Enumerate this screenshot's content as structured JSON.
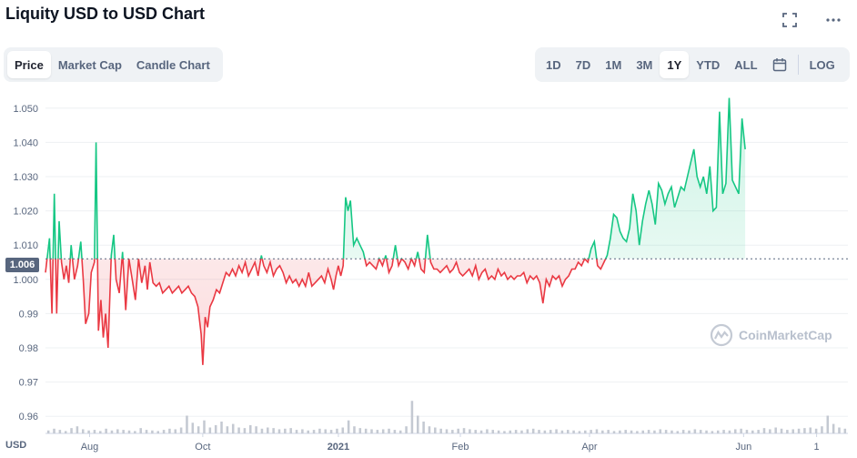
{
  "header": {
    "title": "Liquity USD to USD Chart"
  },
  "icons": {
    "fullscreen": "fullscreen-icon",
    "more": "more-icon",
    "calendar": "calendar-icon",
    "watermark": "coinmarketcap-logo-icon"
  },
  "tabs_left": [
    {
      "label": "Price",
      "active": true
    },
    {
      "label": "Market Cap",
      "active": false
    },
    {
      "label": "Candle Chart",
      "active": false
    }
  ],
  "tabs_right": [
    {
      "label": "1D",
      "active": false
    },
    {
      "label": "7D",
      "active": false
    },
    {
      "label": "1M",
      "active": false
    },
    {
      "label": "3M",
      "active": false
    },
    {
      "label": "1Y",
      "active": true
    },
    {
      "label": "YTD",
      "active": false
    },
    {
      "label": "ALL",
      "active": false
    }
  ],
  "log_label": "LOG",
  "watermark_text": "CoinMarketCap",
  "colors": {
    "up": "#16c784",
    "down": "#ea3943",
    "grid": "#eef0f3",
    "volume": "#c4c9d2"
  },
  "chart_data": {
    "type": "line",
    "reference_value": 1.006,
    "reference_label": "1.006",
    "y_unit_label": "USD",
    "ylim": [
      0.955,
      1.055
    ],
    "y_ticks": [
      0.96,
      0.97,
      0.98,
      0.99,
      1.0,
      1.01,
      1.02,
      1.03,
      1.04,
      1.05
    ],
    "y_tick_labels": [
      "0.96",
      "0.97",
      "0.98",
      "0.99",
      "1.000",
      "1.010",
      "1.020",
      "1.030",
      "1.040",
      "1.050"
    ],
    "x_ticks": [
      {
        "label": "Aug",
        "pos": 0.055
      },
      {
        "label": "Oct",
        "pos": 0.196
      },
      {
        "label": "2021",
        "pos": 0.365
      },
      {
        "label": "Feb",
        "pos": 0.517
      },
      {
        "label": "Apr",
        "pos": 0.678
      },
      {
        "label": "Jun",
        "pos": 0.87
      },
      {
        "label": "1",
        "pos": 0.961
      }
    ],
    "points": [
      [
        0.0,
        1.002
      ],
      [
        0.005,
        1.012
      ],
      [
        0.008,
        0.99
      ],
      [
        0.011,
        1.025
      ],
      [
        0.014,
        0.99
      ],
      [
        0.017,
        1.017
      ],
      [
        0.02,
        1.005
      ],
      [
        0.023,
        1.0
      ],
      [
        0.026,
        1.004
      ],
      [
        0.029,
        0.999
      ],
      [
        0.032,
        1.01
      ],
      [
        0.036,
        1.0
      ],
      [
        0.04,
        1.004
      ],
      [
        0.044,
        1.011
      ],
      [
        0.047,
        1.0
      ],
      [
        0.05,
        0.987
      ],
      [
        0.054,
        0.99
      ],
      [
        0.057,
        1.002
      ],
      [
        0.061,
        1.005
      ],
      [
        0.063,
        1.04
      ],
      [
        0.066,
        0.985
      ],
      [
        0.069,
        0.994
      ],
      [
        0.072,
        0.983
      ],
      [
        0.075,
        0.99
      ],
      [
        0.078,
        0.98
      ],
      [
        0.082,
        1.007
      ],
      [
        0.085,
        1.013
      ],
      [
        0.088,
        1.0
      ],
      [
        0.092,
        0.996
      ],
      [
        0.096,
        1.008
      ],
      [
        0.1,
        0.991
      ],
      [
        0.104,
        1.006
      ],
      [
        0.108,
        1.0
      ],
      [
        0.112,
        0.994
      ],
      [
        0.116,
        1.006
      ],
      [
        0.12,
        0.999
      ],
      [
        0.124,
        1.004
      ],
      [
        0.127,
        0.997
      ],
      [
        0.13,
        1.005
      ],
      [
        0.134,
        0.999
      ],
      [
        0.138,
        0.998
      ],
      [
        0.142,
        0.999
      ],
      [
        0.146,
        0.996
      ],
      [
        0.15,
        0.997
      ],
      [
        0.154,
        0.998
      ],
      [
        0.158,
        0.996
      ],
      [
        0.162,
        0.997
      ],
      [
        0.166,
        0.998
      ],
      [
        0.17,
        0.996
      ],
      [
        0.174,
        0.997
      ],
      [
        0.178,
        0.998
      ],
      [
        0.182,
        0.996
      ],
      [
        0.186,
        0.995
      ],
      [
        0.19,
        0.992
      ],
      [
        0.194,
        0.984
      ],
      [
        0.196,
        0.975
      ],
      [
        0.199,
        0.989
      ],
      [
        0.202,
        0.986
      ],
      [
        0.205,
        0.992
      ],
      [
        0.209,
        0.994
      ],
      [
        0.213,
        0.997
      ],
      [
        0.217,
        0.996
      ],
      [
        0.221,
        0.999
      ],
      [
        0.225,
        1.002
      ],
      [
        0.229,
        1.001
      ],
      [
        0.233,
        1.003
      ],
      [
        0.237,
        1.001
      ],
      [
        0.241,
        1.004
      ],
      [
        0.245,
        1.002
      ],
      [
        0.249,
        1.005
      ],
      [
        0.253,
        1.001
      ],
      [
        0.257,
        1.003
      ],
      [
        0.261,
        1.005
      ],
      [
        0.265,
        1.001
      ],
      [
        0.269,
        1.007
      ],
      [
        0.272,
        1.004
      ],
      [
        0.276,
        1.002
      ],
      [
        0.28,
        1.005
      ],
      [
        0.284,
        1.001
      ],
      [
        0.288,
        1.003
      ],
      [
        0.292,
        1.004
      ],
      [
        0.296,
        1.002
      ],
      [
        0.3,
        0.999
      ],
      [
        0.304,
        1.001
      ],
      [
        0.308,
        0.999
      ],
      [
        0.312,
        1.0
      ],
      [
        0.316,
        0.998
      ],
      [
        0.32,
        1.0
      ],
      [
        0.324,
        0.998
      ],
      [
        0.328,
        1.002
      ],
      [
        0.332,
        0.998
      ],
      [
        0.336,
        0.999
      ],
      [
        0.34,
        1.0
      ],
      [
        0.344,
        1.001
      ],
      [
        0.348,
        0.999
      ],
      [
        0.352,
        1.003
      ],
      [
        0.356,
        1.0
      ],
      [
        0.359,
        0.997
      ],
      [
        0.362,
        1.001
      ],
      [
        0.365,
        1.004
      ],
      [
        0.368,
        1.001
      ],
      [
        0.371,
        1.004
      ],
      [
        0.374,
        1.024
      ],
      [
        0.377,
        1.02
      ],
      [
        0.38,
        1.023
      ],
      [
        0.384,
        1.01
      ],
      [
        0.388,
        1.012
      ],
      [
        0.392,
        1.01
      ],
      [
        0.396,
        1.008
      ],
      [
        0.4,
        1.004
      ],
      [
        0.404,
        1.005
      ],
      [
        0.408,
        1.004
      ],
      [
        0.412,
        1.003
      ],
      [
        0.416,
        1.006
      ],
      [
        0.42,
        1.004
      ],
      [
        0.424,
        1.007
      ],
      [
        0.428,
        1.002
      ],
      [
        0.432,
        1.004
      ],
      [
        0.436,
        1.01
      ],
      [
        0.44,
        1.004
      ],
      [
        0.444,
        1.006
      ],
      [
        0.448,
        1.005
      ],
      [
        0.452,
        1.003
      ],
      [
        0.456,
        1.006
      ],
      [
        0.46,
        1.004
      ],
      [
        0.464,
        1.008
      ],
      [
        0.468,
        1.003
      ],
      [
        0.472,
        1.002
      ],
      [
        0.476,
        1.013
      ],
      [
        0.48,
        1.005
      ],
      [
        0.484,
        1.003
      ],
      [
        0.488,
        1.003
      ],
      [
        0.492,
        1.002
      ],
      [
        0.496,
        1.003
      ],
      [
        0.5,
        1.004
      ],
      [
        0.504,
        1.002
      ],
      [
        0.508,
        1.003
      ],
      [
        0.512,
        1.005
      ],
      [
        0.516,
        1.002
      ],
      [
        0.52,
        1.001
      ],
      [
        0.524,
        1.002
      ],
      [
        0.528,
        1.003
      ],
      [
        0.532,
        1.001
      ],
      [
        0.536,
        1.004
      ],
      [
        0.54,
        1.0
      ],
      [
        0.544,
        1.002
      ],
      [
        0.548,
        1.003
      ],
      [
        0.552,
        1.0
      ],
      [
        0.556,
        1.001
      ],
      [
        0.56,
        1.0
      ],
      [
        0.564,
        1.003
      ],
      [
        0.568,
        1.001
      ],
      [
        0.572,
        1.002
      ],
      [
        0.576,
        1.0
      ],
      [
        0.58,
        1.001
      ],
      [
        0.584,
        1.0
      ],
      [
        0.588,
        1.001
      ],
      [
        0.592,
        1.001
      ],
      [
        0.596,
        1.002
      ],
      [
        0.6,
        0.999
      ],
      [
        0.604,
        1.001
      ],
      [
        0.608,
        1.0
      ],
      [
        0.612,
        1.001
      ],
      [
        0.616,
        0.999
      ],
      [
        0.62,
        0.993
      ],
      [
        0.624,
        1.0
      ],
      [
        0.628,
        0.998
      ],
      [
        0.632,
        1.001
      ],
      [
        0.636,
        1.0
      ],
      [
        0.64,
        1.001
      ],
      [
        0.644,
        0.998
      ],
      [
        0.648,
        1.0
      ],
      [
        0.652,
        1.001
      ],
      [
        0.656,
        1.003
      ],
      [
        0.66,
        1.003
      ],
      [
        0.664,
        1.005
      ],
      [
        0.668,
        1.004
      ],
      [
        0.672,
        1.006
      ],
      [
        0.676,
        1.005
      ],
      [
        0.68,
        1.009
      ],
      [
        0.684,
        1.011
      ],
      [
        0.688,
        1.004
      ],
      [
        0.692,
        1.003
      ],
      [
        0.696,
        1.005
      ],
      [
        0.7,
        1.007
      ],
      [
        0.704,
        1.012
      ],
      [
        0.708,
        1.019
      ],
      [
        0.712,
        1.018
      ],
      [
        0.716,
        1.014
      ],
      [
        0.72,
        1.012
      ],
      [
        0.724,
        1.011
      ],
      [
        0.728,
        1.015
      ],
      [
        0.732,
        1.025
      ],
      [
        0.736,
        1.02
      ],
      [
        0.74,
        1.01
      ],
      [
        0.744,
        1.017
      ],
      [
        0.748,
        1.022
      ],
      [
        0.752,
        1.026
      ],
      [
        0.756,
        1.022
      ],
      [
        0.76,
        1.016
      ],
      [
        0.764,
        1.028
      ],
      [
        0.768,
        1.026
      ],
      [
        0.772,
        1.022
      ],
      [
        0.776,
        1.025
      ],
      [
        0.78,
        1.027
      ],
      [
        0.784,
        1.021
      ],
      [
        0.788,
        1.024
      ],
      [
        0.792,
        1.027
      ],
      [
        0.796,
        1.026
      ],
      [
        0.8,
        1.03
      ],
      [
        0.804,
        1.034
      ],
      [
        0.808,
        1.038
      ],
      [
        0.812,
        1.03
      ],
      [
        0.816,
        1.027
      ],
      [
        0.82,
        1.03
      ],
      [
        0.824,
        1.025
      ],
      [
        0.828,
        1.033
      ],
      [
        0.832,
        1.02
      ],
      [
        0.836,
        1.021
      ],
      [
        0.84,
        1.049
      ],
      [
        0.844,
        1.025
      ],
      [
        0.848,
        1.028
      ],
      [
        0.852,
        1.053
      ],
      [
        0.856,
        1.029
      ],
      [
        0.86,
        1.027
      ],
      [
        0.864,
        1.025
      ],
      [
        0.868,
        1.047
      ],
      [
        0.872,
        1.038
      ]
    ],
    "volume": [
      0.05,
      0.08,
      0.06,
      0.04,
      0.09,
      0.12,
      0.07,
      0.05,
      0.06,
      0.04,
      0.08,
      0.05,
      0.07,
      0.06,
      0.05,
      0.04,
      0.09,
      0.06,
      0.05,
      0.04,
      0.06,
      0.08,
      0.07,
      0.1,
      0.3,
      0.18,
      0.12,
      0.22,
      0.1,
      0.14,
      0.2,
      0.12,
      0.16,
      0.1,
      0.09,
      0.14,
      0.12,
      0.08,
      0.1,
      0.09,
      0.07,
      0.08,
      0.09,
      0.06,
      0.07,
      0.05,
      0.06,
      0.08,
      0.07,
      0.06,
      0.08,
      0.1,
      0.22,
      0.12,
      0.09,
      0.08,
      0.07,
      0.06,
      0.07,
      0.08,
      0.06,
      0.05,
      0.12,
      0.55,
      0.3,
      0.2,
      0.12,
      0.1,
      0.08,
      0.07,
      0.06,
      0.08,
      0.09,
      0.07,
      0.06,
      0.05,
      0.07,
      0.06,
      0.05,
      0.04,
      0.05,
      0.06,
      0.05,
      0.07,
      0.08,
      0.06,
      0.05,
      0.06,
      0.07,
      0.05,
      0.06,
      0.05,
      0.04,
      0.05,
      0.06,
      0.07,
      0.05,
      0.06,
      0.04,
      0.05,
      0.06,
      0.05,
      0.04,
      0.05,
      0.06,
      0.05,
      0.07,
      0.06,
      0.05,
      0.04,
      0.06,
      0.05,
      0.07,
      0.06,
      0.05,
      0.04,
      0.05,
      0.06,
      0.05,
      0.07,
      0.08,
      0.06,
      0.05,
      0.06,
      0.09,
      0.07,
      0.1,
      0.08,
      0.06,
      0.07,
      0.08,
      0.09,
      0.1,
      0.08,
      0.12,
      0.3,
      0.16,
      0.1,
      0.08
    ]
  }
}
